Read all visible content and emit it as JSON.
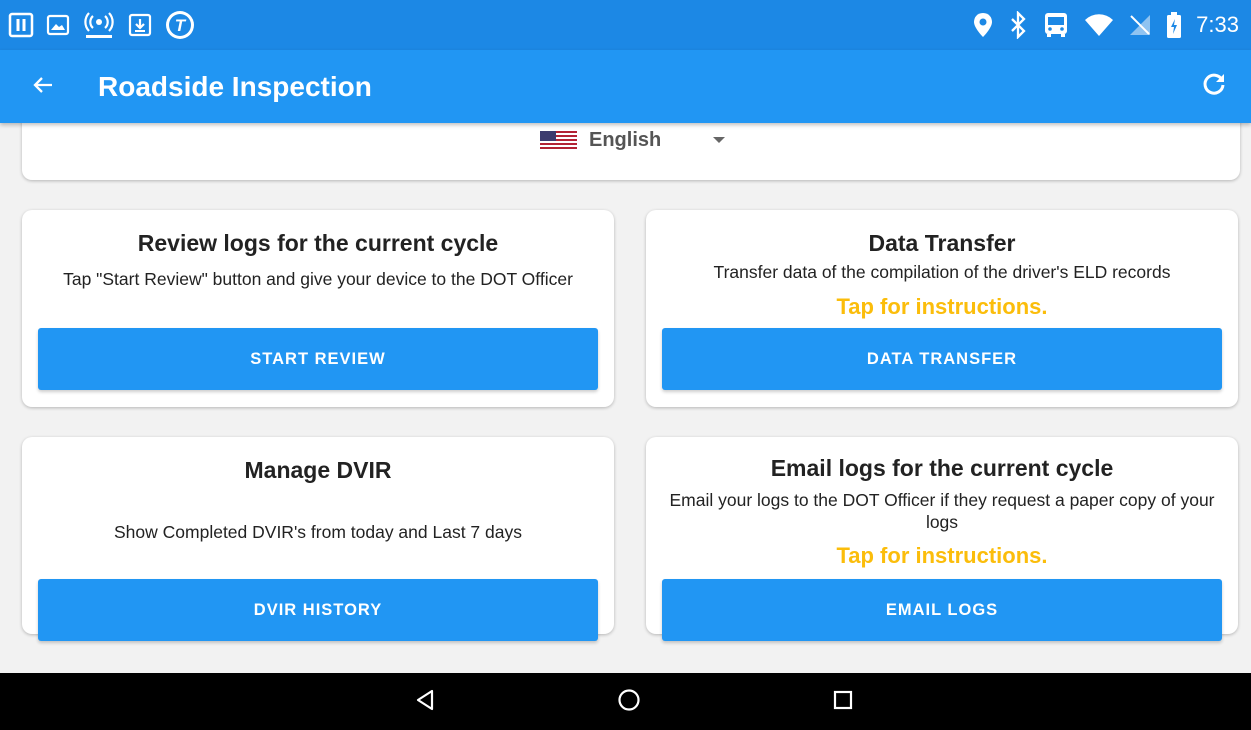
{
  "status_bar": {
    "time": "7:33",
    "left_icons": [
      "pause-box-icon",
      "image-box-icon",
      "hotspot-icon",
      "download-box-icon",
      "t-logo-icon"
    ],
    "right_icons": [
      "location-icon",
      "bluetooth-icon",
      "bus-icon",
      "wifi-icon",
      "no-sim-icon",
      "battery-charging-icon"
    ]
  },
  "app_bar": {
    "title": "Roadside Inspection",
    "back_icon": "arrow-left-icon",
    "refresh_icon": "refresh-icon"
  },
  "language": {
    "selected": "English",
    "flag_icon": "us-flag-icon"
  },
  "cards": {
    "review": {
      "title": "Review logs for the current cycle",
      "description": "Tap \"Start Review\" button and give your device to the DOT Officer",
      "button": "START REVIEW"
    },
    "data_transfer": {
      "title": "Data Transfer",
      "description": "Transfer data of the compilation of the driver's ELD records",
      "link": "Tap for instructions.",
      "button": "DATA TRANSFER"
    },
    "dvir": {
      "title": "Manage DVIR",
      "description": "Show Completed DVIR's from today and Last 7 days",
      "button": "DVIR HISTORY"
    },
    "email": {
      "title": "Email logs for the current cycle",
      "description": "Email your logs to the DOT Officer if they request a paper copy of your logs",
      "link": "Tap for instructions.",
      "button": "EMAIL LOGS"
    }
  },
  "colors": {
    "status_bar": "#1c88e5",
    "app_bar": "#2196f3",
    "button": "#2196f3",
    "link": "#fbbd0b",
    "nav_bar": "#000000"
  },
  "nav_bar": {
    "icons": [
      "back-triangle-icon",
      "home-circle-icon",
      "recents-square-icon"
    ]
  }
}
